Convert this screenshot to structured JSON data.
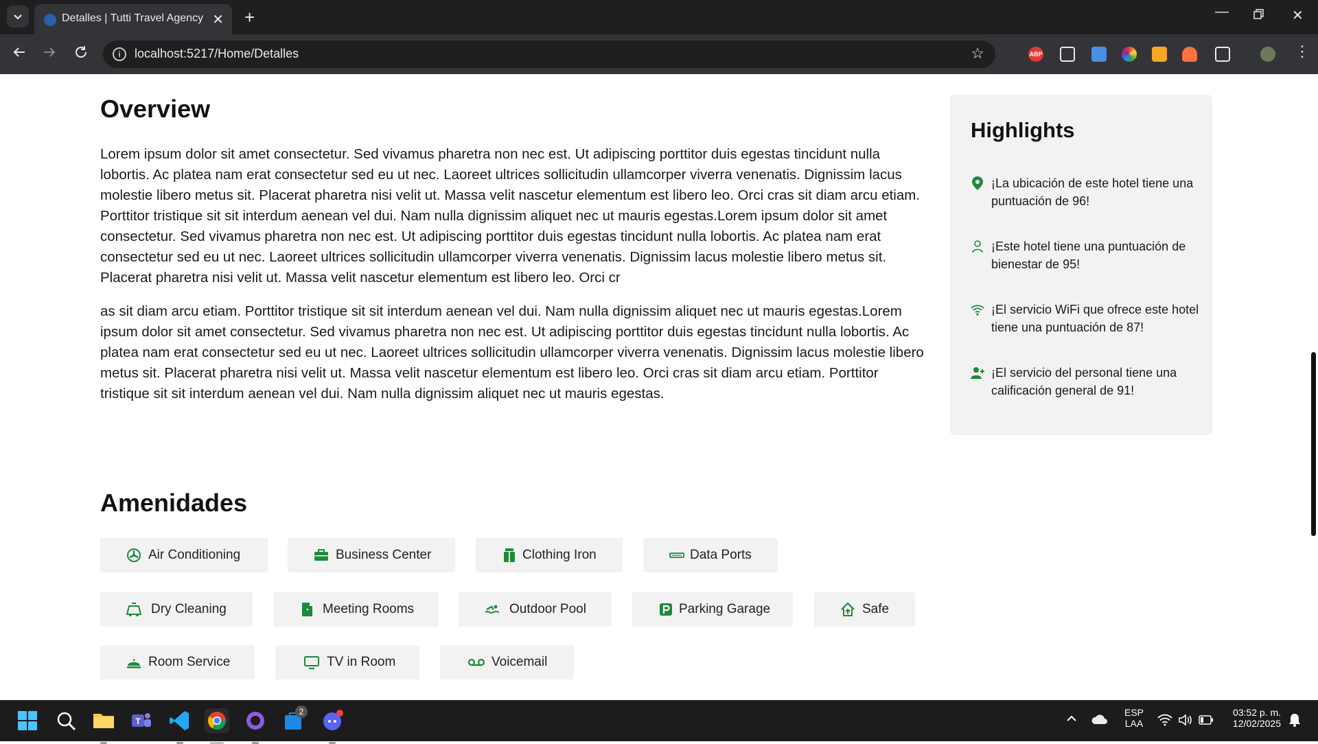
{
  "browser": {
    "tab_title": "Detalles | Tutti Travel Agency",
    "url": "localhost:5217/Home/Detalles",
    "abp_label": "ABP"
  },
  "overview": {
    "title": "Overview",
    "paragraph1": "Lorem ipsum dolor sit amet consectetur. Sed vivamus pharetra non nec est. Ut adipiscing porttitor duis egestas tincidunt nulla lobortis. Ac platea nam erat consectetur sed eu ut nec. Laoreet ultrices sollicitudin ullamcorper viverra venenatis. Dignissim lacus molestie libero metus sit. Placerat pharetra nisi velit ut. Massa velit nascetur elementum est libero leo. Orci cras sit diam arcu etiam. Porttitor tristique sit sit interdum aenean vel dui. Nam nulla dignissim aliquet nec ut mauris egestas.Lorem ipsum dolor sit amet consectetur. Sed vivamus pharetra non nec est. Ut adipiscing porttitor duis egestas tincidunt nulla lobortis. Ac platea nam erat consectetur sed eu ut nec. Laoreet ultrices sollicitudin ullamcorper viverra venenatis. Dignissim lacus molestie libero metus sit. Placerat pharetra nisi velit ut. Massa velit nascetur elementum est libero leo. Orci cr",
    "paragraph2": "as sit diam arcu etiam. Porttitor tristique sit sit interdum aenean vel dui. Nam nulla dignissim aliquet nec ut mauris egestas.Lorem ipsum dolor sit amet consectetur. Sed vivamus pharetra non nec est. Ut adipiscing porttitor duis egestas tincidunt nulla lobortis. Ac platea nam erat consectetur sed eu ut nec. Laoreet ultrices sollicitudin ullamcorper viverra venenatis. Dignissim lacus molestie libero metus sit. Placerat pharetra nisi velit ut. Massa velit nascetur elementum est libero leo. Orci cras sit diam arcu etiam. Porttitor tristique sit sit interdum aenean vel dui. Nam nulla dignissim aliquet nec ut mauris egestas."
  },
  "highlights": {
    "title": "Highlights",
    "items": [
      {
        "icon": "location-pin-icon",
        "text": "¡La ubicación de este hotel tiene una puntuación de 96!"
      },
      {
        "icon": "person-icon",
        "text": "¡Este hotel tiene una puntuación de bienestar de 95!"
      },
      {
        "icon": "wifi-icon",
        "text": "¡El servicio WiFi que ofrece este hotel tiene una puntuación de 87!"
      },
      {
        "icon": "staff-icon",
        "text": "¡El servicio del personal tiene una calificación general de 91!"
      }
    ]
  },
  "amenities": {
    "title": "Amenidades",
    "items": [
      {
        "icon": "fan-icon",
        "label": "Air Conditioning"
      },
      {
        "icon": "briefcase-icon",
        "label": "Business Center"
      },
      {
        "icon": "iron-icon",
        "label": "Clothing Iron"
      },
      {
        "icon": "ethernet-icon",
        "label": "Data Ports"
      },
      {
        "icon": "dry-cleaning-icon",
        "label": "Dry Cleaning"
      },
      {
        "icon": "door-icon",
        "label": "Meeting Rooms"
      },
      {
        "icon": "swimmer-icon",
        "label": "Outdoor Pool"
      },
      {
        "icon": "parking-icon",
        "label": "Parking Garage"
      },
      {
        "icon": "safe-house-icon",
        "label": "Safe"
      },
      {
        "icon": "cloche-icon",
        "label": "Room Service"
      },
      {
        "icon": "tv-icon",
        "label": "TV in Room"
      },
      {
        "icon": "voicemail-icon",
        "label": "Voicemail"
      }
    ]
  },
  "colors": {
    "accent": "#1e8a3a",
    "chip_bg": "#f2f2f2",
    "panel_bg": "#f2f2f2"
  },
  "taskbar": {
    "lang": "ESP",
    "lang_sub": "LAA",
    "time": "03:52 p. m.",
    "date": "12/02/2025",
    "store_badge": "2"
  }
}
